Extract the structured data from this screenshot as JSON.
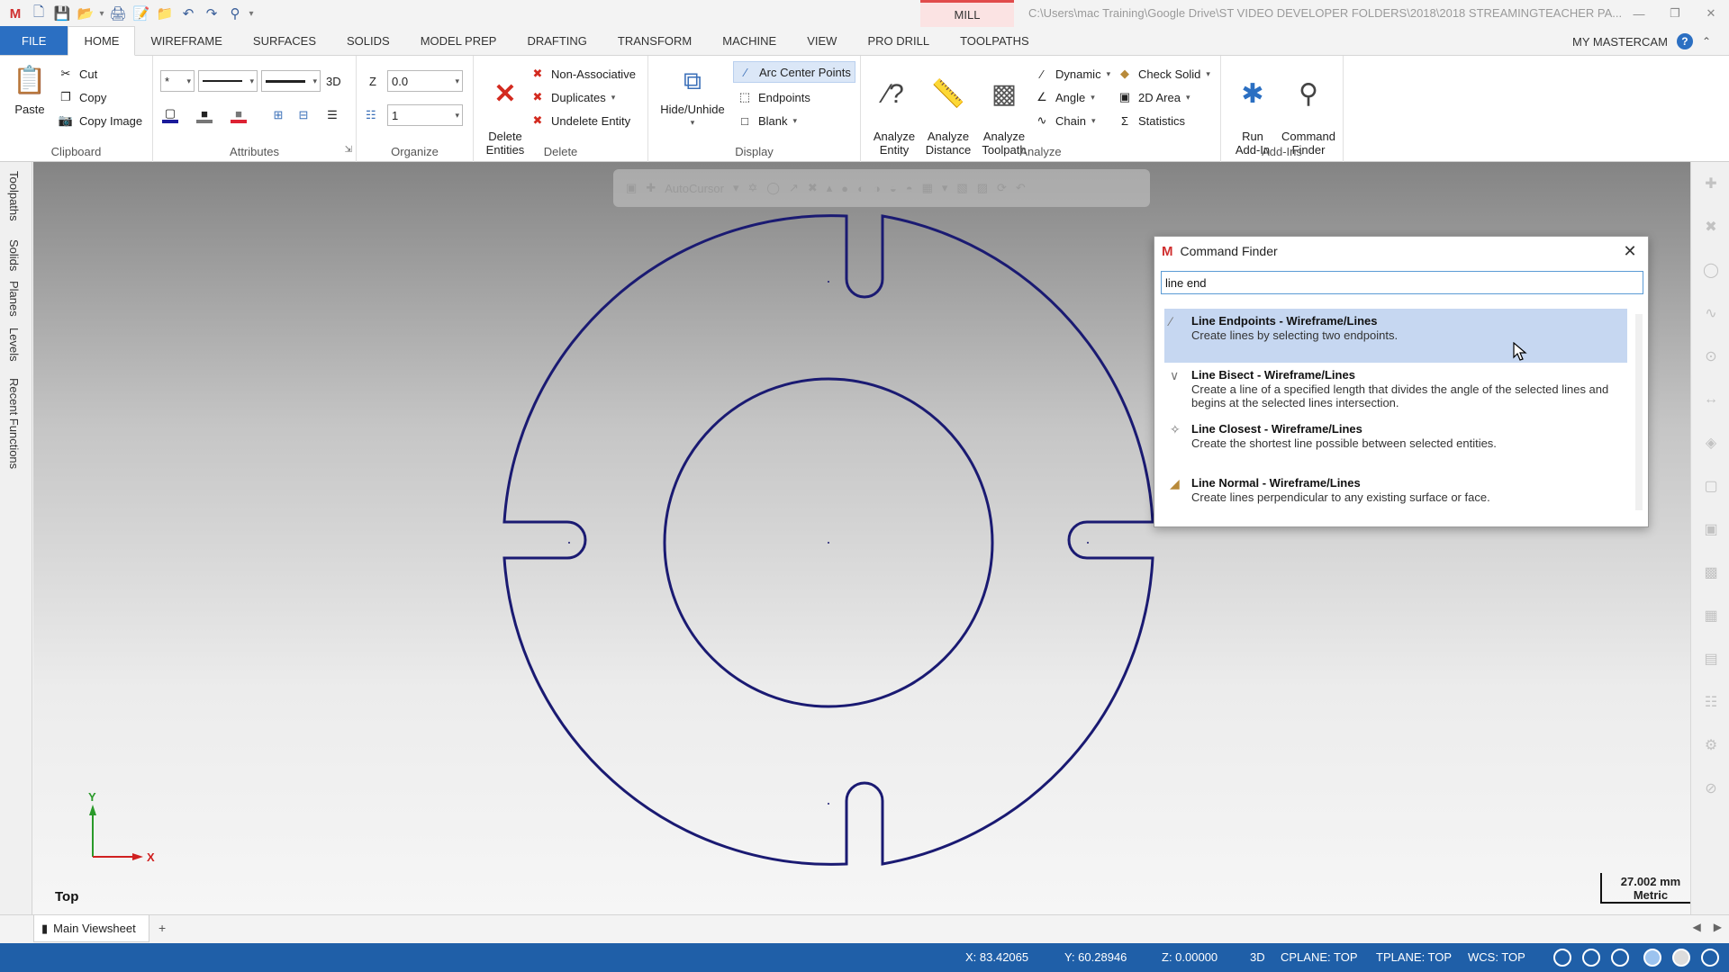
{
  "titlebar": {
    "context_tab": "MILL",
    "window_title": "C:\\Users\\mac Training\\Google Drive\\ST VIDEO DEVELOPER FOLDERS\\2018\\2018 STREAMINGTEACHER PA..."
  },
  "tabs": [
    "FILE",
    "HOME",
    "WIREFRAME",
    "SURFACES",
    "SOLIDS",
    "MODEL PREP",
    "DRAFTING",
    "TRANSFORM",
    "MACHINE",
    "VIEW",
    "PRO DRILL",
    "TOOLPATHS"
  ],
  "active_tab": "HOME",
  "account_label": "MY MASTERCAM",
  "help_label": "?",
  "ribbon": {
    "clipboard": {
      "label": "Clipboard",
      "paste": "Paste",
      "cut": "Cut",
      "copy": "Copy",
      "copy_image": "Copy Image"
    },
    "attributes": {
      "label": "Attributes",
      "point_style": "*",
      "mode_3d": "3D"
    },
    "organize": {
      "label": "Organize",
      "z_label": "Z",
      "z_value": "0.0",
      "level_value": "1"
    },
    "delete": {
      "label": "Delete",
      "delete_entities": "Delete\nEntities",
      "non_associative": "Non-Associative",
      "duplicates": "Duplicates",
      "undelete": "Undelete Entity"
    },
    "display": {
      "label": "Display",
      "hide_unhide": "Hide/Unhide",
      "arc_center_points": "Arc Center Points",
      "endpoints": "Endpoints",
      "blank": "Blank"
    },
    "analyze": {
      "label": "Analyze",
      "analyze_entity": "Analyze\nEntity",
      "analyze_distance": "Analyze\nDistance",
      "analyze_toolpath": "Analyze\nToolpath",
      "dynamic": "Dynamic",
      "angle": "Angle",
      "chain": "Chain",
      "check_solid": "Check Solid",
      "area_2d": "2D Area",
      "statistics": "Statistics"
    },
    "addins": {
      "label": "Add-Ins",
      "run_addin": "Run\nAdd-In",
      "command_finder": "Command\nFinder"
    }
  },
  "managers": [
    "Toolpaths",
    "Solids",
    "Planes",
    "Levels",
    "Recent Functions"
  ],
  "viewport": {
    "autocursor_label": "AutoCursor",
    "view_name": "Top",
    "axis_x": "X",
    "axis_y": "Y",
    "scale_value": "27.002 mm",
    "scale_units": "Metric"
  },
  "command_finder": {
    "title": "Command Finder",
    "query": "line end",
    "results": [
      {
        "name": "Line Endpoints - Wireframe/Lines",
        "desc": "Create lines by selecting two endpoints.",
        "selected": true
      },
      {
        "name": "Line Bisect - Wireframe/Lines",
        "desc": "Create a line of a specified length that divides the angle of the selected lines and begins at the selected lines intersection.",
        "selected": false
      },
      {
        "name": "Line Closest - Wireframe/Lines",
        "desc": "Create the shortest line possible between selected entities.",
        "selected": false
      },
      {
        "name": "Line Normal - Wireframe/Lines",
        "desc": "Create lines perpendicular to any existing surface or face.",
        "selected": false
      }
    ]
  },
  "viewsheet": {
    "tab": "Main Viewsheet",
    "add": "+"
  },
  "status": {
    "x": "X:  83.42065",
    "y": "Y:  60.28946",
    "z": "Z:  0.00000",
    "mode": "3D",
    "cplane": "CPLANE: TOP",
    "tplane": "TPLANE: TOP",
    "wcs": "WCS: TOP"
  },
  "colors": {
    "accent": "#2b6fc2",
    "status_bar": "#1f5fa8",
    "geometry": "#1a1a72",
    "selection": "#c6d7f1",
    "context_tab": "#e14b4b"
  }
}
